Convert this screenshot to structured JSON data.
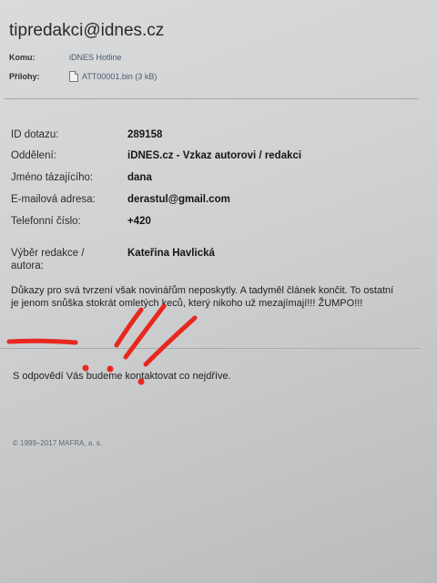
{
  "email": {
    "sender": "tipredakci@idnes.cz",
    "to_label": "Komu:",
    "to_value": "iDNES Hotline",
    "attachments_label": "Přílohy:",
    "attachment_name": "ATT00001.bin (3 kB)",
    "attachment_icon": "file-icon"
  },
  "form": {
    "rows": [
      {
        "label": "ID dotazu:",
        "value": "289158"
      },
      {
        "label": "Oddělení:",
        "value": "iDNES.cz - Vzkaz autorovi / redakci"
      },
      {
        "label": "Jméno tázajícího:",
        "value": "dana"
      },
      {
        "label": "E-mailová adresa:",
        "value": "derastul@gmail.com"
      },
      {
        "label": "Telefonní číslo:",
        "value": "+420"
      },
      {
        "label": "Výběr redakce / autora:",
        "value": "Kateřina Havlická"
      }
    ],
    "message": "Důkazy pro svá tvrzení však novinářům neposkytly. A tadyměl článek končit. To ostatní je jenom snůška stokrát omletých keců, který nikoho už mezajímají!!! ŽUMPO!!!",
    "reply_note": "S odpovědí Vás budeme kontaktovat co nejdříve."
  },
  "footer": {
    "copyright": "© 1999–2017 MAFRA, a. s."
  },
  "colors": {
    "annotation_red": "#e8281e",
    "link_blue": "#4a5b70",
    "rule": "#a4a6a8"
  }
}
